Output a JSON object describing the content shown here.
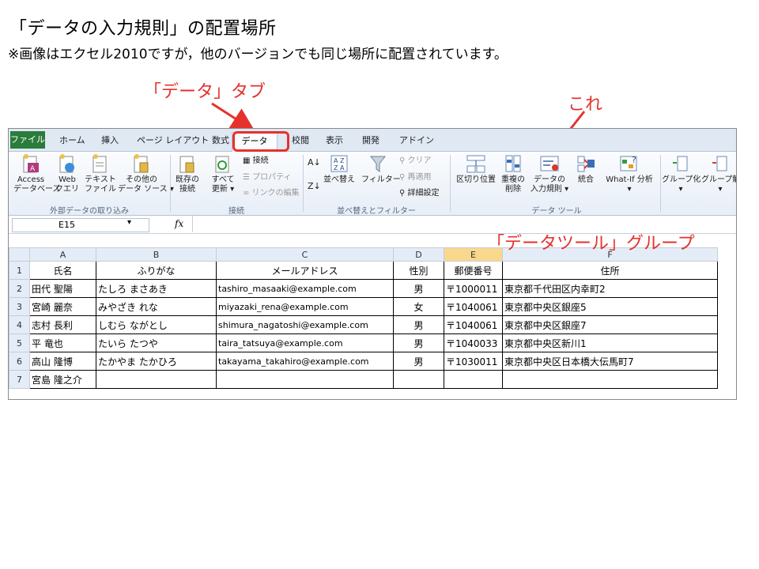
{
  "heading": {
    "title": "「データの入力規則」の配置場所",
    "subtitle": "※画像はエクセル2010ですが，他のバージョンでも同じ場所に配置されています。"
  },
  "annotations": {
    "data_tab": "「データ」タブ",
    "this": "これ",
    "data_tools_group": "「データツール」グループ",
    "color": "#e5322d"
  },
  "ribbon": {
    "tabs": [
      "ファイル",
      "ホーム",
      "挿入",
      "ページ レイアウト",
      "数式",
      "データ",
      "校閲",
      "表示",
      "開発",
      "アドイン"
    ],
    "get_external": {
      "access": [
        "Access",
        "データベース"
      ],
      "web": [
        "Web",
        "クエリ"
      ],
      "text": [
        "テキスト",
        "ファイル"
      ],
      "other": [
        "その他の",
        "データ ソース ▾"
      ],
      "group_label": "外部データの取り込み"
    },
    "connections": {
      "existing": [
        "既存の",
        "接続"
      ],
      "refresh_all": [
        "すべて",
        "更新 ▾"
      ],
      "connections": "接続",
      "properties": "プロパティ",
      "edit_links": "リンクの編集",
      "group_label": "接続"
    },
    "sort_filter": {
      "sort": "並べ替え",
      "filter": "フィルター",
      "clear": "クリア",
      "reapply": "再適用",
      "advanced": "詳細設定",
      "group_label": "並べ替えとフィルター"
    },
    "data_tools": {
      "text_to_columns": "区切り位置",
      "remove_duplicates": [
        "重複の",
        "削除"
      ],
      "data_validation": [
        "データの",
        "入力規則 ▾"
      ],
      "consolidate": "統合",
      "what_if": [
        "What-If 分析",
        "▾"
      ],
      "group_label": "データ ツール"
    },
    "outline": {
      "group": [
        "グループ化",
        "▾"
      ],
      "ungroup": [
        "グループ解",
        "▾"
      ]
    }
  },
  "formula_bar": {
    "name_box": "E15",
    "fx": "fx",
    "formula": ""
  },
  "sheet": {
    "columns": [
      "A",
      "B",
      "C",
      "D",
      "E",
      "F"
    ],
    "selected_column": "E",
    "rows": [
      {
        "n": "1",
        "cells": [
          "氏名",
          "ふりがな",
          "メールアドレス",
          "性別",
          "郵便番号",
          "住所"
        ]
      },
      {
        "n": "2",
        "cells": [
          "田代 聖陽",
          "たしろ まさあき",
          "tashiro_masaaki@example.com",
          "男",
          "〒1000011",
          "東京都千代田区内幸町2"
        ]
      },
      {
        "n": "3",
        "cells": [
          "宮崎 麗奈",
          "みやざき れな",
          "miyazaki_rena@example.com",
          "女",
          "〒1040061",
          "東京都中央区銀座5"
        ]
      },
      {
        "n": "4",
        "cells": [
          "志村 長利",
          "しむら ながとし",
          "shimura_nagatoshi@example.com",
          "男",
          "〒1040061",
          "東京都中央区銀座7"
        ]
      },
      {
        "n": "5",
        "cells": [
          "平 竜也",
          "たいら たつや",
          "taira_tatsuya@example.com",
          "男",
          "〒1040033",
          "東京都中央区新川1"
        ]
      },
      {
        "n": "6",
        "cells": [
          "高山 隆博",
          "たかやま たかひろ",
          "takayama_takahiro@example.com",
          "男",
          "〒1030011",
          "東京都中央区日本橋大伝馬町7"
        ]
      },
      {
        "n": "7",
        "cells": [
          "宮島 隆之介",
          "",
          "",
          "",
          "",
          ""
        ]
      }
    ]
  }
}
